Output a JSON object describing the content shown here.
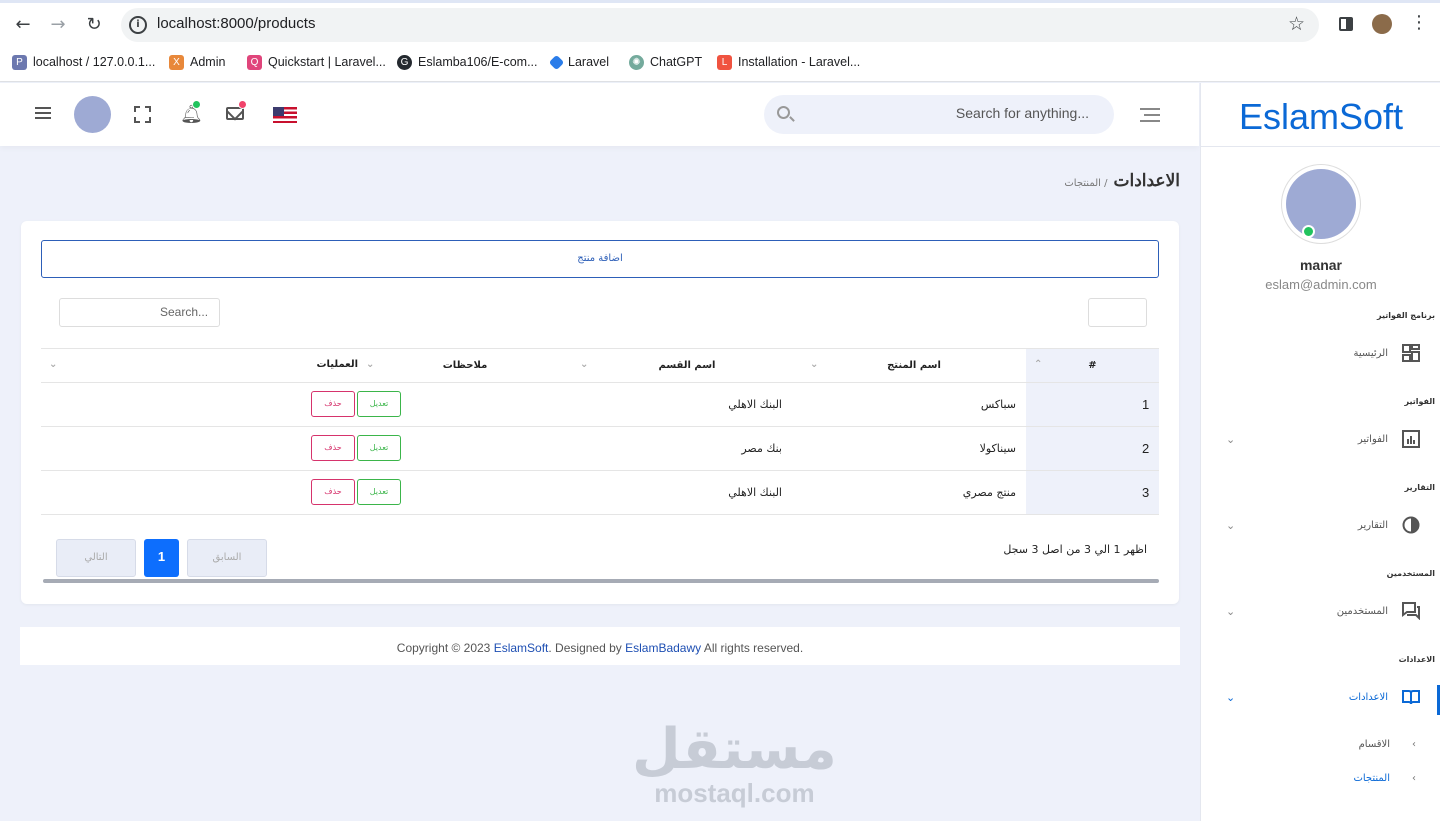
{
  "browser": {
    "url": "localhost:8000/products",
    "bookmarks": [
      {
        "label": "localhost / 127.0.0.1...",
        "color": "#6c78af"
      },
      {
        "label": "Admin",
        "color": "#e8883a"
      },
      {
        "label": "Quickstart | Laravel...",
        "color": "#e0457b"
      },
      {
        "label": "Eslamba106/E-com...",
        "color": "#24292f"
      },
      {
        "label": "Laravel",
        "color": "#2b7de9"
      },
      {
        "label": "ChatGPT",
        "color": "#74aa9c"
      },
      {
        "label": "Installation - Laravel...",
        "color": "#f05340"
      }
    ]
  },
  "topbar": {
    "search_placeholder": "Search for anything..."
  },
  "breadcrumb": {
    "title": "الاعدادات",
    "sub": "/ المنتجات"
  },
  "products": {
    "add_label": "اضافة منتج",
    "search_placeholder": "Search...",
    "columns": [
      "#",
      "اسم المنتج",
      "اسم القسم",
      "ملاحظات",
      "العمليات"
    ],
    "rows": [
      {
        "num": "1",
        "name": "سباكس",
        "section": "البنك الاهلي",
        "notes": ""
      },
      {
        "num": "2",
        "name": "سيناكولا",
        "section": "بنك مصر",
        "notes": ""
      },
      {
        "num": "3",
        "name": "منتج مصري",
        "section": "البنك الاهلي",
        "notes": ""
      }
    ],
    "edit_label": "تعديل",
    "delete_label": "حذف",
    "info": "اظهر 1 الي 3 من اصل 3 سجل",
    "prev": "السابق",
    "page": "1",
    "next": "التالي"
  },
  "footer": {
    "pre": "Copyright © 2023 ",
    "brand": "EslamSoft",
    "mid": ". Designed by ",
    "author": "EslamBadawy",
    "post": " All rights reserved."
  },
  "watermark": {
    "ar": "مستقل",
    "en": "mostaql.com"
  },
  "sidebar": {
    "logo": "EslamSoft",
    "user": {
      "name": "manar",
      "email": "eslam@admin.com"
    },
    "sections": [
      {
        "title": "برنامج الفواتير",
        "item": "الرئيسية"
      },
      {
        "title": "الفواتير",
        "item": "الفواتير"
      },
      {
        "title": "التقارير",
        "item": "التقارير"
      },
      {
        "title": "المستخدمين",
        "item": "المستخدمين"
      },
      {
        "title": "الاعدادات",
        "item": "الاعدادات"
      }
    ],
    "subitems": [
      "الاقسام",
      "المنتجات"
    ],
    "accent": "#0b69d6"
  }
}
